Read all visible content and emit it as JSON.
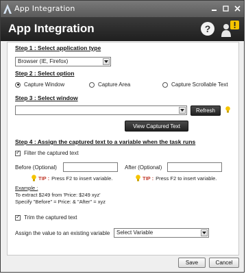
{
  "titlebar": {
    "title": "App Integration"
  },
  "header": {
    "heading": "App Integration",
    "help_glyph": "?"
  },
  "step1": {
    "title": "Step 1 : Select application type",
    "selected": "Browser (IE, Firefox)"
  },
  "step2": {
    "title": "Step 2 : Select option",
    "options": [
      "Capture Window",
      "Capture Area",
      "Capture Scrollable Text"
    ],
    "selected_index": 0
  },
  "step3": {
    "title": "Step 3 : Select window",
    "window_value": "",
    "refresh_label": "Refresh",
    "view_label": "View Captured Text"
  },
  "step4": {
    "title": "Step 4 : Assign the captured text to a variable when the task runs",
    "filter_label": "Filter the captured text",
    "filter_checked": true,
    "before_label": "Before (Optional)",
    "after_label": "After (Optional)",
    "tip_word": "TIP :",
    "tip_text": "Press F2 to insert variable.",
    "example_title": "Example :",
    "example_line1": "To extract $249 from 'Price: $249 xyz'",
    "example_line2": "Specify \"Before\" = Price: & \"After\" = xyz",
    "trim_label": "Trim the captured text",
    "trim_checked": true,
    "assign_label": "Assign the value to an existing variable",
    "variable_selected": "Select Variable"
  },
  "footer": {
    "save_label": "Save",
    "cancel_label": "Cancel"
  },
  "colors": {
    "header_bg": "#2a2a2a",
    "tip_red": "#c0392b",
    "bulb_yellow": "#f5c400"
  },
  "icons": [
    "app-logo-icon",
    "minimize-icon",
    "maximize-icon",
    "close-icon",
    "help-icon",
    "user-alert-icon",
    "lightbulb-icon"
  ]
}
